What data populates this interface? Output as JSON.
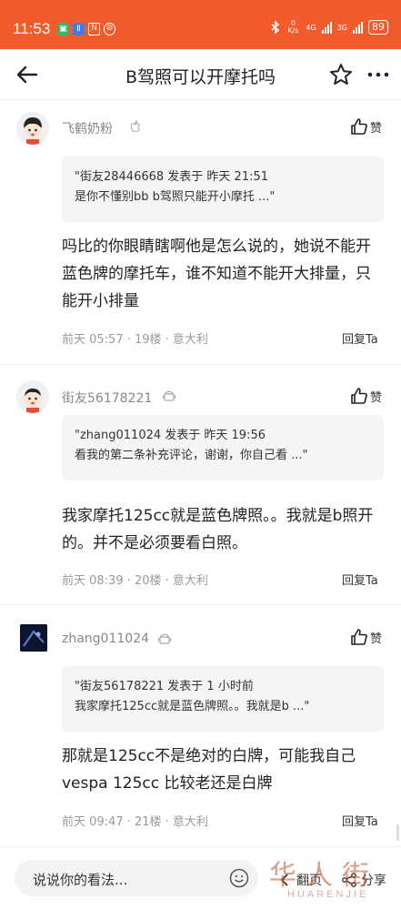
{
  "status_bar": {
    "time": "11:53",
    "net_speed": "0\nK/s",
    "net1": "4G",
    "net2": "3G",
    "battery": "89"
  },
  "nav": {
    "title": "B驾照可以开摩托吗"
  },
  "comments": [
    {
      "username": "飞鹤奶粉",
      "device": "apple-icon",
      "like_label": "赞",
      "quote_line1": "\"街友28446668 发表于 昨天 21:51",
      "quote_line2": "是你不懂别bb b驾照只能开小摩托 ...\"",
      "body": "吗比的你眼睛瞎啊他是怎么说的，她说不能开蓝色牌的摩托车，谁不知道不能开大排量，只能开小排量",
      "meta": "前天 05:57 · 19楼 · 意大利",
      "reply_label": "回复Ta"
    },
    {
      "username": "街友56178221",
      "device": "android-icon",
      "like_label": "赞",
      "quote_line1": "\"zhang011024 发表于 昨天 19:56",
      "quote_line2": "看我的第二条补充评论，谢谢，你自己看 ...\"",
      "body": "我家摩托125cc就是蓝色牌照。。我就是b照开的。并不是必须要看白照。",
      "meta": "前天 08:39 · 20楼 · 意大利",
      "reply_label": "回复Ta"
    },
    {
      "username": "zhang011024",
      "device": "android-icon",
      "like_label": "赞",
      "quote_line1": "\"街友56178221 发表于 1 小时前",
      "quote_line2": "我家摩托125cc就是蓝色牌照。。我就是b ...\"",
      "body": "那就是125cc不是绝对的白牌，可能我自己vespa 125cc 比较老还是白牌",
      "meta": "前天 09:47 · 21楼 · 意大利",
      "reply_label": "回复Ta"
    }
  ],
  "bottom": {
    "placeholder": "说说你的看法...",
    "page_flip": "翻页",
    "share": "分享",
    "watermark_cn": "华人街",
    "watermark_en": "HUARENJIE"
  },
  "colors": {
    "brand": "#f25b2b"
  }
}
